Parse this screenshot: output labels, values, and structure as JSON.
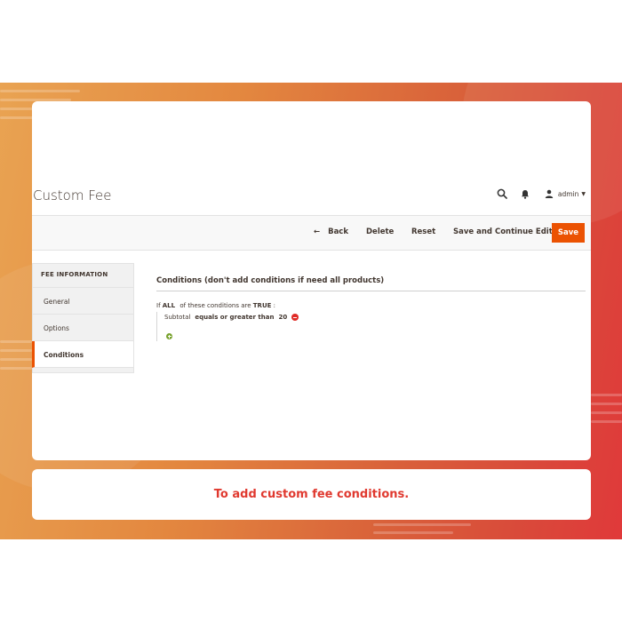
{
  "header": {
    "title": "Custom Fee",
    "user": "admin",
    "icons": [
      "search-icon",
      "bell-icon",
      "user-icon",
      "caret-down-icon"
    ]
  },
  "toolbar": {
    "back_label": "Back",
    "delete_label": "Delete",
    "reset_label": "Reset",
    "save_continue_label": "Save and Continue Edit",
    "save_label": "Save"
  },
  "sidebar": {
    "heading": "FEE INFORMATION",
    "items": [
      {
        "label": "General"
      },
      {
        "label": "Options"
      },
      {
        "label": "Conditions"
      }
    ],
    "active": "Conditions"
  },
  "conditions": {
    "section_title": "Conditions (don't add conditions if need all products)",
    "rule_prefix": "If",
    "aggregator": "ALL",
    "rule_middle": "of these conditions are",
    "value": "TRUE",
    "rule_suffix": ":",
    "condition": {
      "attribute": "Subtotal",
      "operator": "equals or greater than",
      "amount": "20"
    }
  },
  "caption": {
    "text": "To add custom fee conditions."
  },
  "colors": {
    "accent": "#eb5202",
    "remove": "#e02b27",
    "add": "#79a22e",
    "caption_text": "#e0392f"
  }
}
